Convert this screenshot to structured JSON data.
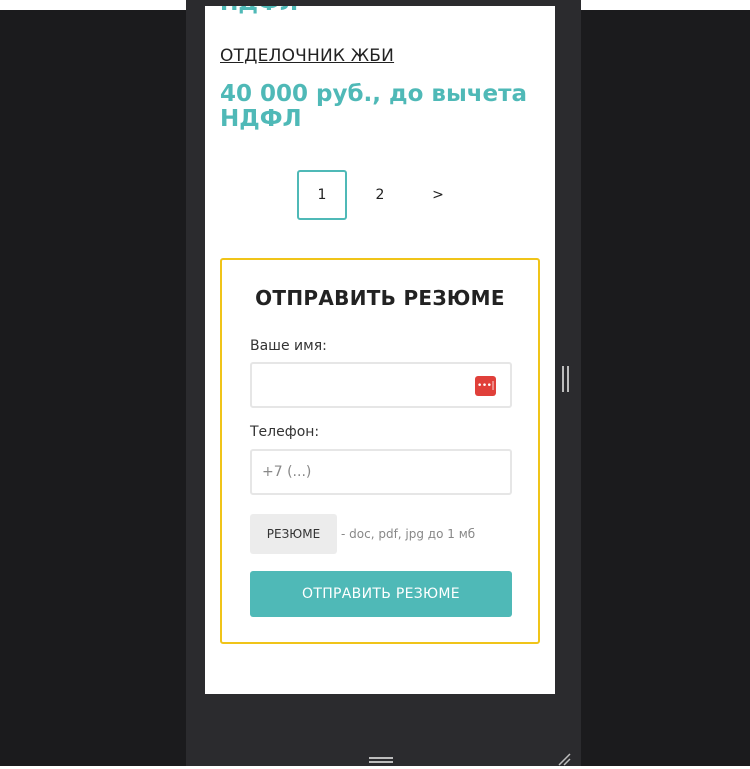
{
  "vacancies": [
    {
      "salary": "НДФЛ"
    },
    {
      "title": "ОТДЕЛОЧНИК ЖБИ",
      "salary": "40 000 руб., до вычета НДФЛ"
    }
  ],
  "pagination": {
    "pages": [
      "1",
      "2"
    ],
    "next": ">"
  },
  "form": {
    "title": "ОТПРАВИТЬ РЕЗЮМЕ",
    "name_label": "Ваше имя:",
    "name_value": "",
    "phone_label": "Телефон:",
    "phone_placeholder": "+7 (...)",
    "file_button": "РЕЗЮМЕ",
    "file_hint": "- doc, pdf, jpg до 1 мб",
    "submit": "ОТПРАВИТЬ РЕЗЮМЕ"
  },
  "colors": {
    "accent": "#4fb9b7",
    "form_border": "#f0c419",
    "password_icon": "#e0403a"
  }
}
